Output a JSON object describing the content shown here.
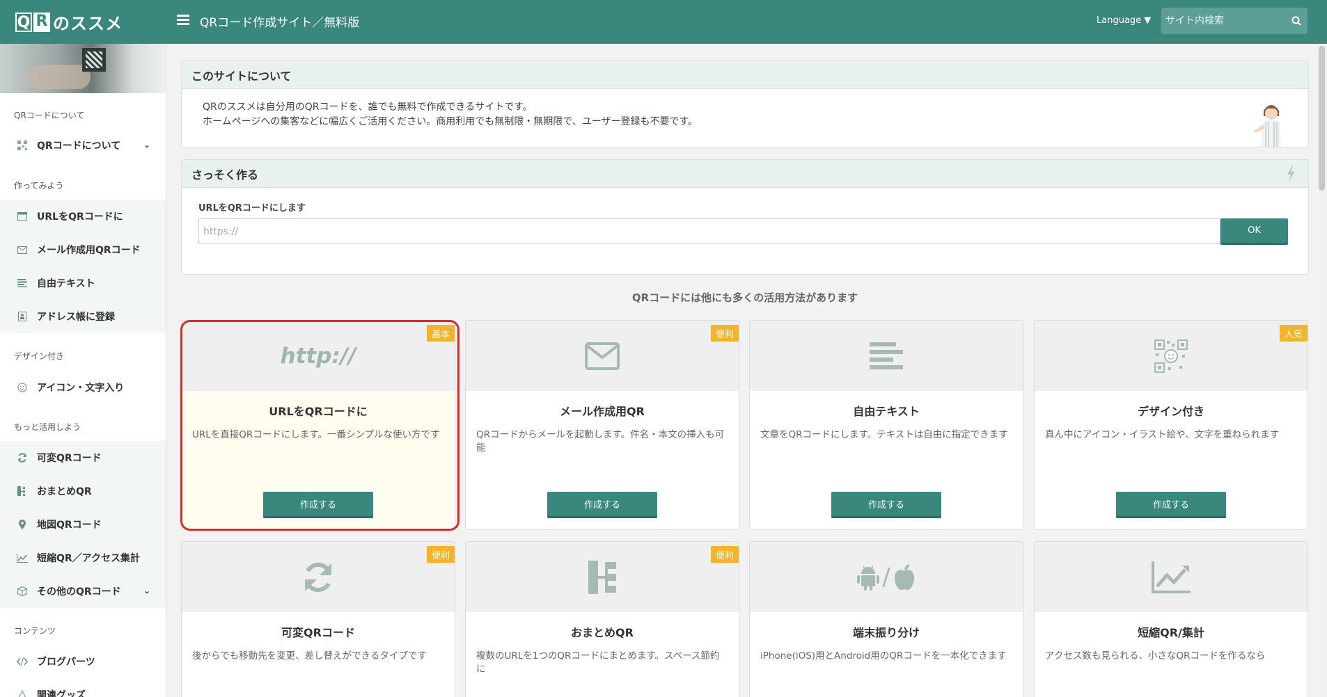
{
  "header": {
    "logo_q": "Q",
    "logo_r": "R",
    "logo_text": "のススメ",
    "title": "QRコード作成サイト／無料版",
    "language_label": "Language ▼",
    "search_placeholder": "サイト内検索"
  },
  "sidebar": {
    "sections": [
      {
        "label": "QRコードについて"
      },
      {
        "label": "作ってみよう"
      },
      {
        "label": "デザイン付き"
      },
      {
        "label": "もっと活用しよう"
      },
      {
        "label": "コンテンツ"
      }
    ],
    "items": [
      {
        "label": "QRコードについて",
        "icon": "qr-grid-icon"
      },
      {
        "label": "URLをQRコードに",
        "icon": "window-icon"
      },
      {
        "label": "メール作成用QRコード",
        "icon": "envelope-icon"
      },
      {
        "label": "自由テキスト",
        "icon": "text-lines-icon"
      },
      {
        "label": "アドレス帳に登録",
        "icon": "contact-icon"
      },
      {
        "label": "アイコン・文字入り",
        "icon": "smile-icon"
      },
      {
        "label": "可変QRコード",
        "icon": "refresh-icon"
      },
      {
        "label": "おまとめQR",
        "icon": "sitemap-icon"
      },
      {
        "label": "地図QRコード",
        "icon": "map-pin-icon"
      },
      {
        "label": "短縮QR／アクセス集計",
        "icon": "line-chart-icon"
      },
      {
        "label": "その他のQRコード",
        "icon": "cube-icon"
      },
      {
        "label": "ブログパーツ",
        "icon": "code-icon"
      },
      {
        "label": "関連グッズ",
        "icon": "goods-icon"
      }
    ]
  },
  "about": {
    "title": "このサイトについて",
    "line1": "QRのススメは自分用のQRコードを、誰でも無料で作成できるサイトです。",
    "line2": "ホームページへの集客などに幅広くご活用ください。商用利用でも無制限・無期限で、ユーザー登録も不要です。"
  },
  "quick": {
    "title": "さっそく作る",
    "form_label": "URLをQRコードにします",
    "input_placeholder": "https://",
    "ok_label": "OK"
  },
  "section_title": "QRコードには他にも多くの活用方法があります",
  "cards": [
    {
      "title": "URLをQRコードに",
      "desc": "URLを直接QRコードにします。一番シンプルな使い方です",
      "badge": "基本",
      "icon": "http-text-icon",
      "icon_text": "http://",
      "button": "作成する"
    },
    {
      "title": "メール作成用QR",
      "desc": "QRコードからメールを起動します。件名・本文の挿入も可能",
      "badge": "便利",
      "icon": "envelope-icon",
      "button": "作成する"
    },
    {
      "title": "自由テキスト",
      "desc": "文章をQRコードにします。テキストは自由に指定できます",
      "badge": "",
      "icon": "text-lines-icon",
      "button": "作成する"
    },
    {
      "title": "デザイン付き",
      "desc": "真ん中にアイコン・イラスト絵や、文字を重ねられます",
      "badge": "人気",
      "icon": "qr-smile-icon",
      "button": "作成する"
    },
    {
      "title": "可変QRコード",
      "desc": "後からでも移動先を変更、差し替えができるタイプです",
      "badge": "便利",
      "icon": "refresh-icon"
    },
    {
      "title": "おまとめQR",
      "desc": "複数のURLを1つのQRコードにまとめます。スペース節約に",
      "badge": "便利",
      "icon": "sitemap-icon"
    },
    {
      "title": "端末振り分け",
      "desc": "iPhone(iOS)用とAndroid用のQRコードを一本化できます",
      "badge": "",
      "icon": "android-apple-icon",
      "icon_sep": "/"
    },
    {
      "title": "短縮QR/集計",
      "desc": "アクセス数も見られる、小さなQRコードを作るなら",
      "badge": "",
      "icon": "line-chart-icon"
    }
  ],
  "colors": {
    "brand": "#3a877e",
    "badge": "#f3b32a",
    "highlight": "#d62c2c"
  }
}
